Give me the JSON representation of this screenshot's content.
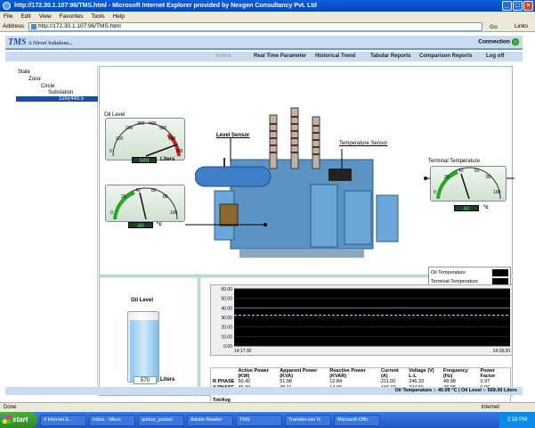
{
  "window": {
    "title": "http://172.30.1.107:96/TMS.html - Microsoft Internet Explorer provided by Nexgen Consultancy Pvt. Ltd"
  },
  "menu": [
    "File",
    "Edit",
    "View",
    "Favorites",
    "Tools",
    "Help"
  ],
  "address": {
    "label": "Address",
    "url": "http://172.30.1.107:96/TMS.html",
    "go": "Go",
    "links": "Links"
  },
  "header": {
    "logo": "TMS",
    "tagline": "A Nirvoi Solutions...",
    "connection": "Connection"
  },
  "nav": [
    "Select",
    "Real Time Parameter",
    "Historical Trend",
    "Tabular Reports",
    "Comparison Reports",
    "Log off"
  ],
  "tree": [
    "State",
    "Zone",
    "Circle",
    "Substation",
    "1stv(449.5"
  ],
  "gauges": {
    "oil_level": {
      "title": "Oil Level",
      "ticks": [
        "0",
        "100",
        "200",
        "300",
        "400",
        "500",
        "600",
        "700"
      ],
      "unit": "Liters",
      "value": 569
    },
    "oil_temp": {
      "ticks": [
        "0",
        "20",
        "40",
        "60",
        "80",
        "100"
      ],
      "unit": "°c",
      "value": 40
    },
    "terminal_temp": {
      "title": "Terminal Temperature",
      "ticks": [
        "0",
        "20",
        "40",
        "60",
        "80",
        "100"
      ],
      "unit": "°c",
      "value": 40
    }
  },
  "labels": {
    "level_sensor": "Level Sensor",
    "temperature_sensor": "Temperature Sensor",
    "oil_level_tank": "Oil Level",
    "tank_unit": "Liters",
    "tank_value": "570"
  },
  "legend": [
    "Oil Temperature",
    "Terminal Temperature"
  ],
  "chart_data": {
    "type": "line",
    "ylim": [
      0,
      60
    ],
    "yticks": [
      "60.00",
      "50.00",
      "40.00",
      "30.00",
      "20.00",
      "10.00",
      "0.00"
    ],
    "x": [
      "14:17:30",
      "14:18:20"
    ],
    "series": [
      {
        "name": "Oil Temperature",
        "values": [
          40.1,
          40.0,
          40.0,
          40.1,
          40.0,
          40.0
        ],
        "color": "#4a7fc0"
      },
      {
        "name": "Terminal Temperature",
        "values": [
          32.3,
          32.3,
          32.4,
          32.3,
          32.3,
          32.4
        ],
        "color": "#a9d0ef"
      }
    ]
  },
  "table": {
    "headers": [
      "",
      "Active Power (KW)",
      "Apparent Power (KVA)",
      "Reactive Power (KVAR)",
      "Current (A)",
      "Voltage (V) L-L",
      "Frequency (Hz)",
      "Power Factor"
    ],
    "rows": [
      [
        "R PHASE",
        "50.42",
        "51.98",
        "12.84",
        "211.00",
        "246.33",
        "48.98",
        "0.97"
      ],
      [
        "Y PHASE",
        "45.90",
        "48.11",
        "14.00",
        "196.00",
        "244.56",
        "48.98",
        "0.96"
      ],
      [
        "B PHASE",
        "54.95",
        "57.42",
        "16.66",
        "234.00",
        "245.37",
        "48.98",
        "0.96"
      ],
      [
        "Tot/Avg",
        "",
        "",
        "",
        "",
        "",
        "",
        ""
      ]
    ]
  },
  "footer": "Oil Temperature :- 40.09 °C  |  Oil Level :- 569.00 Liters",
  "status": {
    "left": "Done",
    "zone": "Internet"
  },
  "taskbar": {
    "start": "start",
    "tasks": [
      "4 Internet E...",
      "Inbox - Micro",
      "author_pocket",
      "Adobe Reader",
      "TMS",
      "Transfer.exe N",
      "Microsoft Offic"
    ],
    "time": "2:18 PM"
  }
}
